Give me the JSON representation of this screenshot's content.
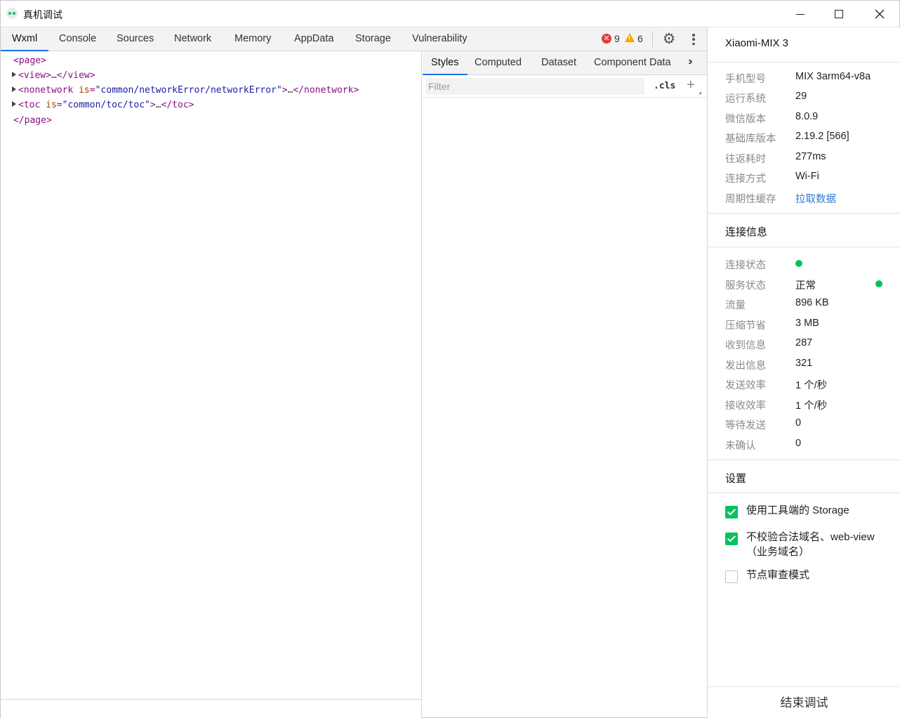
{
  "window": {
    "title": "真机调试"
  },
  "tabs": [
    "Wxml",
    "Console",
    "Sources",
    "Network",
    "Memory",
    "AppData",
    "Storage",
    "Vulnerability"
  ],
  "active_tab": "Wxml",
  "status": {
    "errors": "9",
    "warnings": "6"
  },
  "wxml": {
    "page_open": "<page>",
    "page_close": "</page>",
    "view": {
      "open": "<view>",
      "ellipsis": "…",
      "close": "</view>"
    },
    "nonetwork": {
      "tag": "<nonetwork",
      "attr": "is",
      "value": "\"common/networkError/networkError\"",
      "gt": ">",
      "ellipsis": "…",
      "close": "</nonetwork>"
    },
    "toc": {
      "tag": "<toc",
      "attr": "is",
      "value": "\"common/toc/toc\"",
      "gt": ">",
      "ellipsis": "…",
      "close": "</toc>"
    }
  },
  "styles_tabs": [
    "Styles",
    "Computed",
    "Dataset",
    "Component Data"
  ],
  "filter": {
    "placeholder": "Filter",
    "cls_label": ".cls"
  },
  "panel": {
    "device": "Xiaomi-MIX 3",
    "info": [
      {
        "label": "手机型号",
        "value": "MIX 3arm64-v8a"
      },
      {
        "label": "运行系统",
        "value": "29"
      },
      {
        "label": "微信版本",
        "value": "8.0.9"
      },
      {
        "label": "基础库版本",
        "value": "2.19.2 [566]"
      },
      {
        "label": "往返耗时",
        "value": "277ms"
      },
      {
        "label": "连接方式",
        "value": "Wi-Fi"
      },
      {
        "label": "周期性缓存",
        "value": "拉取数据"
      }
    ],
    "connection_title": "连接信息",
    "connection": [
      {
        "label": "连接状态",
        "value": ""
      },
      {
        "label": "服务状态",
        "value": "正常"
      },
      {
        "label": "流量",
        "value": "896 KB"
      },
      {
        "label": "压缩节省",
        "value": "3 MB"
      },
      {
        "label": "收到信息",
        "value": "287"
      },
      {
        "label": "发出信息",
        "value": "321"
      },
      {
        "label": "发送效率",
        "value": "1 个/秒"
      },
      {
        "label": "接收效率",
        "value": "1 个/秒"
      },
      {
        "label": "等待发送",
        "value": "0"
      },
      {
        "label": "未确认",
        "value": "0"
      }
    ],
    "settings_title": "设置",
    "settings": [
      {
        "label": "使用工具端的 Storage",
        "checked": true
      },
      {
        "label": "不校验合法域名、web-view（业务域名）",
        "checked": true
      },
      {
        "label": "节点审查模式",
        "checked": false
      }
    ],
    "end_button": "结束调试"
  },
  "colors": {
    "accent": "#1a73e8",
    "green": "#07c160",
    "link": "#2f7ad8",
    "error": "#e53935",
    "warning": "#f2a600"
  }
}
